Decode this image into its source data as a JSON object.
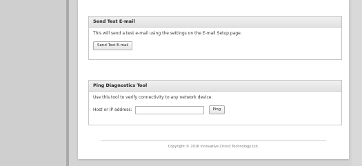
{
  "email_test": {
    "title": "Send Test E-mail",
    "description": "This will send a test e-mail using the settings on the E-mail Setup page.",
    "button_label": "Send Test E-mail"
  },
  "ping_tool": {
    "title": "Ping Diagnostics Tool",
    "description": "Use this tool to verify connectivity to any network device.",
    "host_label": "Host or IP address:",
    "host_value": "",
    "button_label": "Ping"
  },
  "footer": {
    "copyright": "Copyright © 2016 Innovative Circuit Technology Ltd."
  }
}
